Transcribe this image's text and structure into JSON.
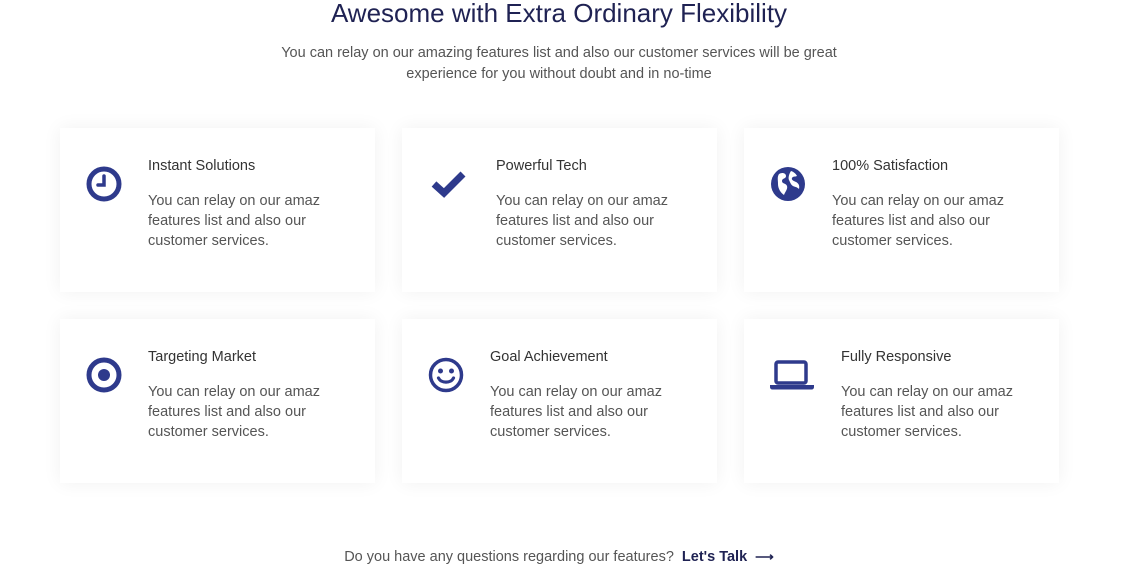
{
  "section": {
    "title": "Awesome with Extra Ordinary Flexibility",
    "subtitle_line1": "You can relay on our amazing features list and also our customer services will be great",
    "subtitle_line2": "experience for you without doubt and in no-time"
  },
  "accent_color": "#2e3a8c",
  "features": [
    {
      "title": "Instant Solutions",
      "icon": "clock-icon",
      "desc": [
        "You can relay on our amaz",
        "features list and also our",
        "customer services."
      ]
    },
    {
      "title": "Powerful Tech",
      "icon": "checkmark-icon",
      "desc": [
        "You can relay on our amaz",
        "features list and also our",
        "customer services."
      ]
    },
    {
      "title": "100% Satisfaction",
      "icon": "globe-icon",
      "desc": [
        "You can relay on our amaz",
        "features list and also our",
        "customer services."
      ]
    },
    {
      "title": "Targeting Market",
      "icon": "target-icon",
      "desc": [
        "You can relay on our amaz",
        "features list and also our",
        "customer services."
      ]
    },
    {
      "title": "Goal Achievement",
      "icon": "smiley-icon",
      "desc": [
        "You can relay on our amaz",
        "features list and also our",
        "customer services."
      ]
    },
    {
      "title": "Fully Responsive",
      "icon": "laptop-icon",
      "desc": [
        "You can relay on our amaz",
        "features list and also our",
        "customer services."
      ]
    }
  ],
  "footer": {
    "question": "Do you have any questions regarding our features?",
    "cta": "Let's Talk",
    "arrow": "⟶"
  }
}
